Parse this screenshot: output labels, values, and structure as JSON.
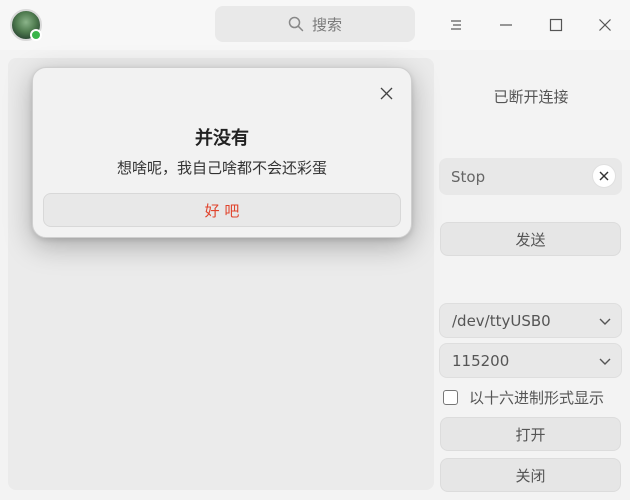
{
  "titlebar": {
    "search_placeholder": "搜索",
    "icons": [
      "app-icon",
      "search-icon",
      "menu-icon",
      "minimize-icon",
      "maximize-icon",
      "close-icon"
    ]
  },
  "right_panel": {
    "status": "已断开连接",
    "send_input_value": "Stop",
    "send_button": "发送",
    "port_select": "/dev/ttyUSB0",
    "baud_select": "115200",
    "hex_checkbox_label": "以十六进制形式显示",
    "hex_checked": false,
    "open_button": "打开",
    "close_button": "关闭"
  },
  "dialog": {
    "title": "并没有",
    "message": "想啥呢，我自己啥都不会还彩蛋",
    "confirm_button": "好 吧",
    "confirm_color": "#e0432c"
  }
}
